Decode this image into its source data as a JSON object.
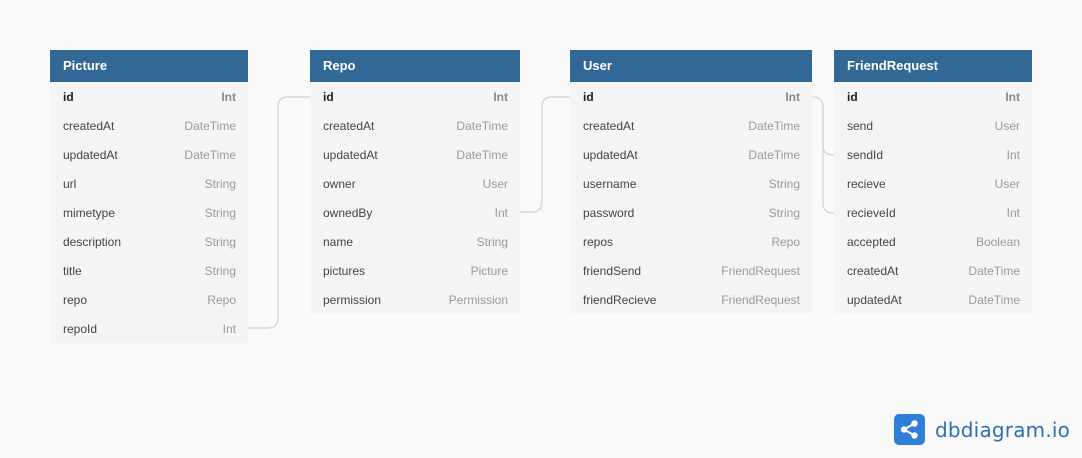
{
  "tables": [
    {
      "name": "Picture",
      "fields": [
        {
          "name": "id",
          "type": "Int",
          "pk": true
        },
        {
          "name": "createdAt",
          "type": "DateTime"
        },
        {
          "name": "updatedAt",
          "type": "DateTime"
        },
        {
          "name": "url",
          "type": "String"
        },
        {
          "name": "mimetype",
          "type": "String"
        },
        {
          "name": "description",
          "type": "String"
        },
        {
          "name": "title",
          "type": "String"
        },
        {
          "name": "repo",
          "type": "Repo"
        },
        {
          "name": "repoId",
          "type": "Int"
        }
      ]
    },
    {
      "name": "Repo",
      "fields": [
        {
          "name": "id",
          "type": "Int",
          "pk": true
        },
        {
          "name": "createdAt",
          "type": "DateTime"
        },
        {
          "name": "updatedAt",
          "type": "DateTime"
        },
        {
          "name": "owner",
          "type": "User"
        },
        {
          "name": "ownedBy",
          "type": "Int"
        },
        {
          "name": "name",
          "type": "String"
        },
        {
          "name": "pictures",
          "type": "Picture"
        },
        {
          "name": "permission",
          "type": "Permission"
        }
      ]
    },
    {
      "name": "User",
      "fields": [
        {
          "name": "id",
          "type": "Int",
          "pk": true
        },
        {
          "name": "createdAt",
          "type": "DateTime"
        },
        {
          "name": "updatedAt",
          "type": "DateTime"
        },
        {
          "name": "username",
          "type": "String"
        },
        {
          "name": "password",
          "type": "String"
        },
        {
          "name": "repos",
          "type": "Repo"
        },
        {
          "name": "friendSend",
          "type": "FriendRequest"
        },
        {
          "name": "friendRecieve",
          "type": "FriendRequest"
        }
      ]
    },
    {
      "name": "FriendRequest",
      "fields": [
        {
          "name": "id",
          "type": "Int",
          "pk": true
        },
        {
          "name": "send",
          "type": "User"
        },
        {
          "name": "sendId",
          "type": "Int"
        },
        {
          "name": "recieve",
          "type": "User"
        },
        {
          "name": "recieveId",
          "type": "Int"
        },
        {
          "name": "accepted",
          "type": "Boolean"
        },
        {
          "name": "createdAt",
          "type": "DateTime"
        },
        {
          "name": "updatedAt",
          "type": "DateTime"
        }
      ]
    }
  ],
  "relations": [
    {
      "from": "Picture.repoId",
      "to": "Repo.id"
    },
    {
      "from": "Repo.ownedBy",
      "to": "User.id"
    },
    {
      "from": "FriendRequest.sendId",
      "to": "User.id"
    },
    {
      "from": "FriendRequest.recieveId",
      "to": "User.id"
    }
  ],
  "brand": {
    "name": "dbdiagram.io",
    "icon": "share-icon",
    "color": "#2f7fd8"
  },
  "colors": {
    "header": "#316896",
    "background": "#fafafa",
    "table_body": "#f5f5f5"
  }
}
